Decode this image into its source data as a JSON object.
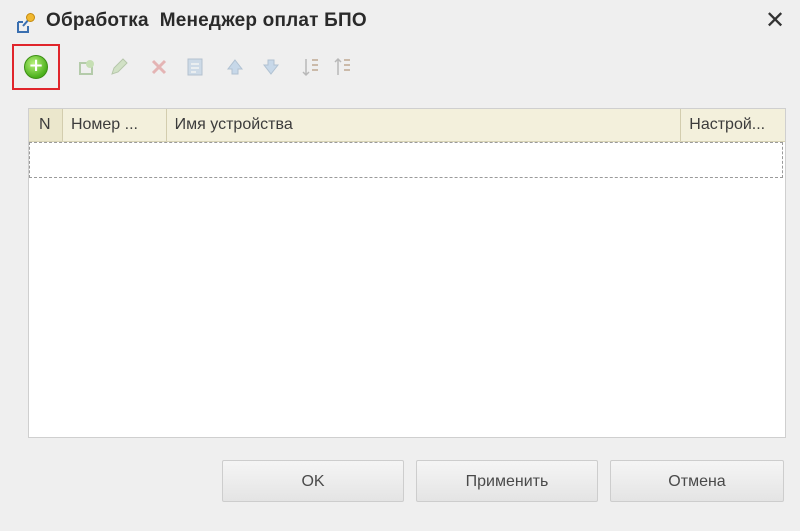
{
  "window": {
    "title": "Обработка  Менеджер оплат БПО",
    "close_symbol": "✕"
  },
  "toolbar": {
    "buttons": [
      {
        "name": "add",
        "icon": "add-circle-icon",
        "symbol": "+",
        "highlighted": true,
        "highlight_color": "#e0252b"
      },
      {
        "name": "copy",
        "icon": "copy-icon"
      },
      {
        "name": "edit",
        "icon": "pencil-icon"
      },
      {
        "name": "delete",
        "icon": "delete-x-icon"
      },
      {
        "name": "post",
        "icon": "document-icon"
      },
      {
        "name": "move-up",
        "icon": "up-icon"
      },
      {
        "name": "move-down",
        "icon": "down-icon"
      },
      {
        "name": "sort-asc",
        "icon": "sort-ascending-icon"
      },
      {
        "name": "sort-desc",
        "icon": "sort-descending-icon"
      }
    ]
  },
  "table": {
    "columns": [
      "N",
      "Номер ...",
      "Имя устройства",
      "Настрой..."
    ],
    "rows": []
  },
  "buttons": {
    "ok": "OK",
    "apply": "Применить",
    "cancel": "Отмена"
  },
  "colors": {
    "header_bg": "#f3f0dc",
    "add_green": "#4cb01b",
    "highlight_red": "#e0252b"
  }
}
